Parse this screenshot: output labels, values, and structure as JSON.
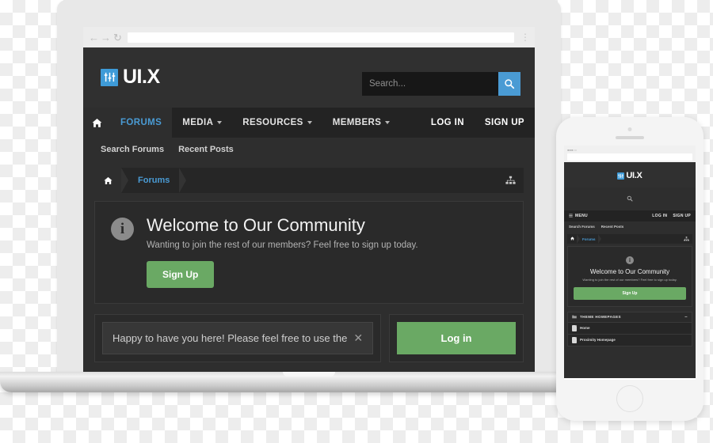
{
  "browser": {
    "back_icon": "arrow-left-icon",
    "forward_icon": "arrow-right-icon",
    "reload_icon": "reload-icon",
    "menu_icon": "kebab-menu-icon",
    "url_value": "",
    "url_placeholder": ""
  },
  "site": {
    "logo_text": "UI.X",
    "logo_mark_icon": "sliders-icon",
    "logo_mark_color": "#3e9bd8",
    "search": {
      "placeholder": "Search...",
      "value": "",
      "button_icon": "search-icon",
      "button_color": "#4a9bd4"
    },
    "nav": {
      "home_icon": "home-icon",
      "items": [
        {
          "label": "FORUMS",
          "active": true,
          "has_caret": false
        },
        {
          "label": "MEDIA",
          "active": false,
          "has_caret": true
        },
        {
          "label": "RESOURCES",
          "active": false,
          "has_caret": true
        },
        {
          "label": "MEMBERS",
          "active": false,
          "has_caret": true
        }
      ],
      "right_items": [
        {
          "label": "LOG IN"
        },
        {
          "label": "SIGN UP"
        }
      ]
    },
    "sub_nav": [
      {
        "label": "Search Forums"
      },
      {
        "label": "Recent Posts"
      }
    ],
    "breadcrumb": {
      "home_icon": "home-icon",
      "items": [
        {
          "label": "Forums"
        }
      ],
      "sitemap_icon": "sitemap-icon"
    },
    "welcome": {
      "icon": "info-icon",
      "title": "Welcome to Our Community",
      "subtitle": "Wanting to join the rest of our members? Feel free to sign up today.",
      "button_label": "Sign Up",
      "button_color": "#6aa964"
    },
    "notice": {
      "text": "Happy to have you here! Please feel free to use the",
      "close_icon": "close-icon"
    },
    "login": {
      "button_label": "Log in",
      "button_color": "#6aa964"
    }
  },
  "phone": {
    "status_left": "●●●○○",
    "status_center": "",
    "status_right": "",
    "url_value": "",
    "logo_text": "UI.X",
    "logo_mark_icon": "sliders-icon",
    "search_icon": "search-icon",
    "nav": {
      "menu_icon": "hamburger-icon",
      "menu_label": "MENU",
      "right_items": [
        {
          "label": "LOG IN"
        },
        {
          "label": "SIGN UP"
        }
      ]
    },
    "sub_nav": [
      {
        "label": "Search Forums"
      },
      {
        "label": "Recent Posts"
      }
    ],
    "breadcrumb": {
      "home_icon": "home-icon",
      "items": [
        {
          "label": "Forums"
        }
      ],
      "sitemap_icon": "sitemap-icon"
    },
    "welcome": {
      "icon": "info-icon",
      "title": "Welcome to Our Community",
      "subtitle": "Wanting to join the rest of our members? Feel free to sign up today.",
      "button_label": "Sign Up"
    },
    "category": {
      "folder_icon": "folder-icon",
      "title": "THEME HOMEPAGES",
      "collapse_icon": "minus-icon",
      "rows": [
        {
          "icon": "document-icon",
          "label": "Home"
        },
        {
          "icon": "document-icon",
          "label": "Proximity Homepage"
        }
      ]
    }
  }
}
